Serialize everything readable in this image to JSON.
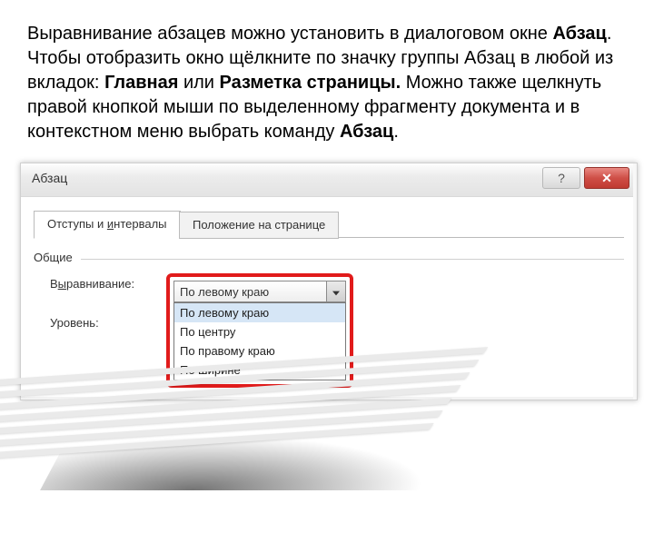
{
  "paragraph": {
    "t1": "Выравнивание абзацев можно установить в диалоговом окне ",
    "b1": "Абзац",
    "t2": ". Чтобы отобразить окно щёлкните по значку группы Абзац в любой из вкладок: ",
    "b2": "Главная",
    "t3": " или ",
    "b3": "Разметка страницы.",
    "t4": "  Можно также щелкнуть правой кнопкой мыши по выделенному фрагменту документа и в контекстном меню  выбрать команду ",
    "b4": "Абзац",
    "t5": "."
  },
  "dialog": {
    "title": "Абзац",
    "help_symbol": "?",
    "close_symbol": "✕",
    "tabs": {
      "active_pre": "Отступы и ",
      "active_u": "и",
      "active_post": "нтервалы",
      "inactive": "Положение на странице"
    },
    "group_label": "Общие",
    "row1_pre": "В",
    "row1_u": "ы",
    "row1_post": "равнивание:",
    "row2_pre": "Уровень",
    "row2_u": ":",
    "combo_value": "По левому краю",
    "options": {
      "o1": "По левому краю",
      "o2": "По центру",
      "o3": "По правому краю",
      "o4": "По ширине"
    }
  }
}
